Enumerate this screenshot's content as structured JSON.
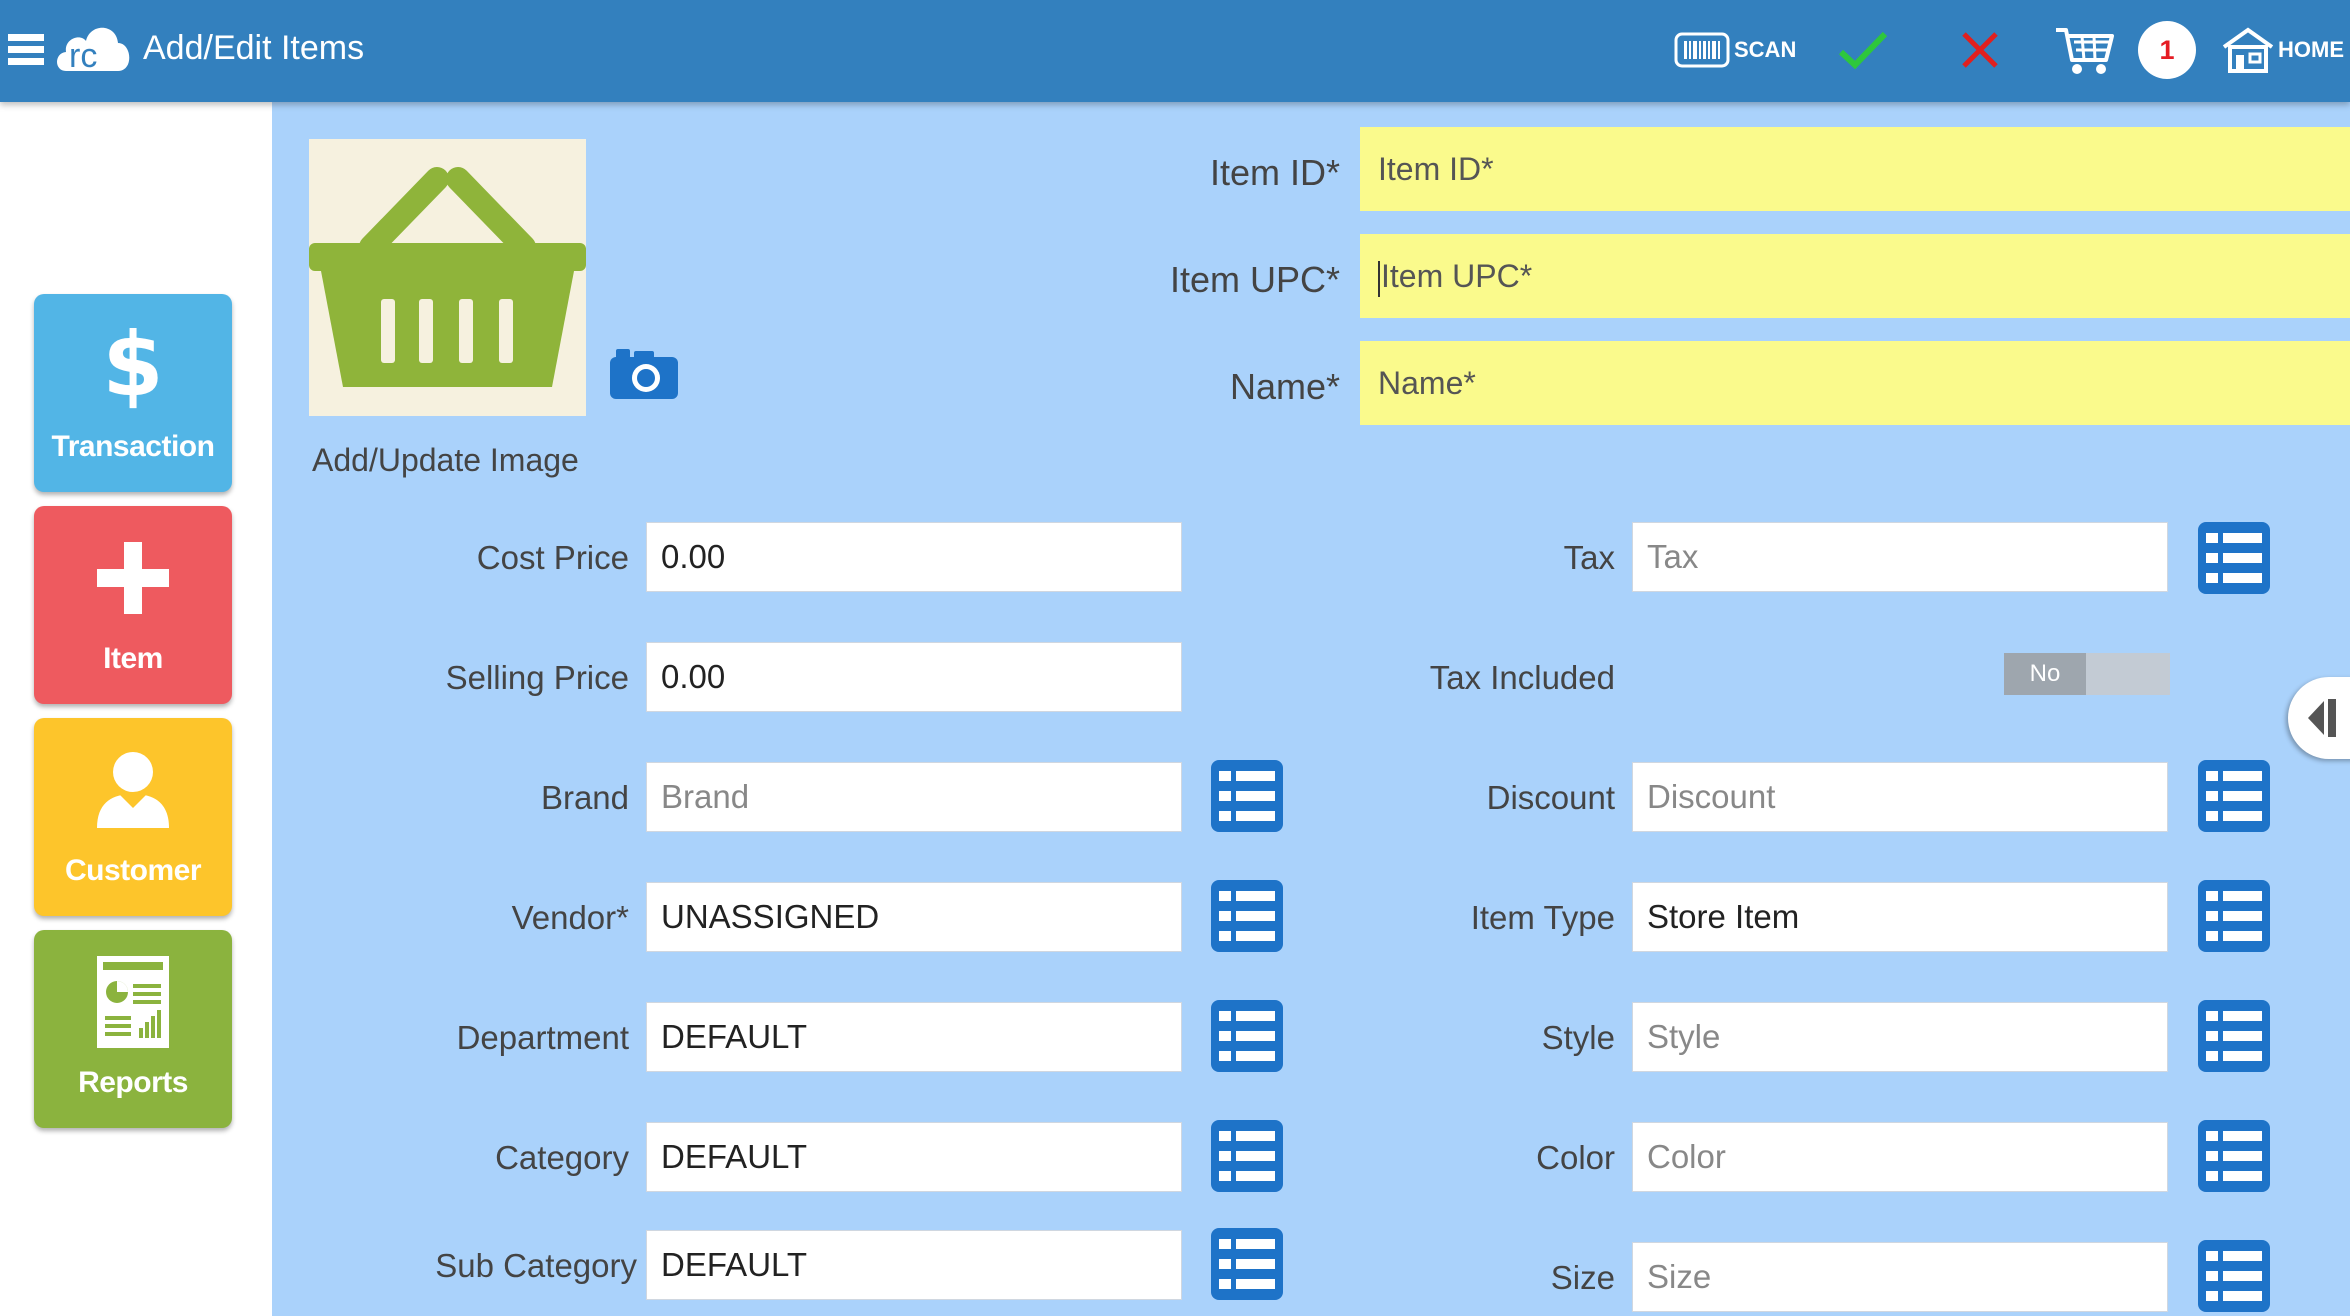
{
  "header": {
    "title": "Add/Edit Items",
    "scan_label": "SCAN",
    "cart_count": "1",
    "home_label": "HOME",
    "colors": {
      "bar": "#3380be",
      "check": "#2ec73c",
      "cross": "#e0201f",
      "badge_text": "#e51c23"
    }
  },
  "sidebar": {
    "items": [
      {
        "label": "Transaction",
        "icon": "dollar-icon",
        "color": "#52b5e6"
      },
      {
        "label": "Item",
        "icon": "plus-icon",
        "color": "#ee5a5f"
      },
      {
        "label": "Customer",
        "icon": "person-icon",
        "color": "#fdc52b"
      },
      {
        "label": "Reports",
        "icon": "report-icon",
        "color": "#8bb33e"
      }
    ]
  },
  "image": {
    "caption": "Add/Update Image",
    "icon": "basket-icon"
  },
  "main": {
    "item_id": {
      "label": "Item ID*",
      "placeholder": "Item ID*"
    },
    "item_upc": {
      "label": "Item UPC*",
      "placeholder": "Item UPC*"
    },
    "name": {
      "label": "Name*",
      "placeholder": "Name*"
    },
    "left_fields": [
      {
        "label": "Cost Price",
        "value": "0.00"
      },
      {
        "label": "Selling Price",
        "value": "0.00"
      },
      {
        "label": "Brand",
        "value": "",
        "placeholder": "Brand"
      },
      {
        "label": "Vendor*",
        "value": "UNASSIGNED"
      },
      {
        "label": "Department",
        "value": "DEFAULT"
      },
      {
        "label": "Category",
        "value": "DEFAULT"
      },
      {
        "label": "Sub Category",
        "value": "DEFAULT"
      }
    ],
    "right_fields": [
      {
        "label": "Tax",
        "value": "",
        "placeholder": "Tax"
      },
      {
        "label": "Tax Included",
        "toggle": "No"
      },
      {
        "label": "Discount",
        "value": "",
        "placeholder": "Discount"
      },
      {
        "label": "Item Type",
        "value": "Store Item"
      },
      {
        "label": "Style",
        "value": "",
        "placeholder": "Style"
      },
      {
        "label": "Color",
        "value": "",
        "placeholder": "Color"
      },
      {
        "label": "Size",
        "value": "",
        "placeholder": "Size"
      }
    ],
    "colors": {
      "background": "#aad2fb",
      "required_field": "#fafa8c",
      "list_icon": "#1e73c8"
    }
  }
}
